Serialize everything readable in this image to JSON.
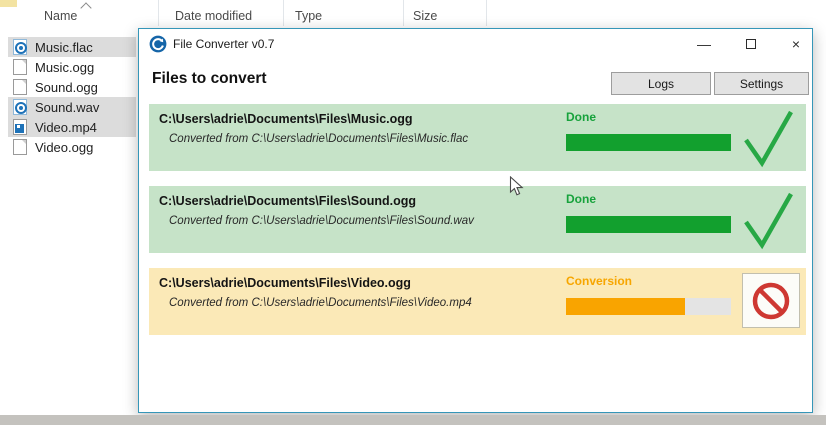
{
  "explorer": {
    "columns": [
      {
        "label": "Name",
        "sorted": "asc"
      },
      {
        "label": "Date modified",
        "sorted": ""
      },
      {
        "label": "Type",
        "sorted": ""
      },
      {
        "label": "Size",
        "sorted": ""
      }
    ],
    "files": [
      {
        "name": "Music.flac",
        "icon": "media-file-icon",
        "icon_class": "icon-media",
        "selected": true
      },
      {
        "name": "Music.ogg",
        "icon": "generic-file-icon",
        "icon_class": "icon-file",
        "selected": false
      },
      {
        "name": "Sound.ogg",
        "icon": "generic-file-icon",
        "icon_class": "icon-file",
        "selected": false
      },
      {
        "name": "Sound.wav",
        "icon": "media-file-icon",
        "icon_class": "icon-media",
        "selected": true
      },
      {
        "name": "Video.mp4",
        "icon": "video-file-icon",
        "icon_class": "icon-video",
        "selected": true
      },
      {
        "name": "Video.ogg",
        "icon": "generic-file-icon",
        "icon_class": "icon-file",
        "selected": false
      }
    ]
  },
  "window": {
    "title": "File Converter v0.7",
    "heading": "Files to convert",
    "logs_button": "Logs",
    "settings_button": "Settings",
    "minimize_glyph": "—",
    "close_glyph": "×"
  },
  "conversions": [
    {
      "output": "C:\\Users\\adrie\\Documents\\Files\\Music.ogg",
      "source": "Converted from C:\\Users\\adrie\\Documents\\Files\\Music.flac",
      "status": "Done",
      "state": "done",
      "progress": 100
    },
    {
      "output": "C:\\Users\\adrie\\Documents\\Files\\Sound.ogg",
      "source": "Converted from C:\\Users\\adrie\\Documents\\Files\\Sound.wav",
      "status": "Done",
      "state": "done",
      "progress": 100
    },
    {
      "output": "C:\\Users\\adrie\\Documents\\Files\\Video.ogg",
      "source": "Converted from C:\\Users\\adrie\\Documents\\Files\\Video.mp4",
      "status": "Conversion",
      "state": "in-progress",
      "progress": 72
    }
  ],
  "colors": {
    "done_text_green": "#17a23c",
    "progress_green": "#12a02e",
    "check_green": "#27a845",
    "card_green": "#c6e3c8",
    "card_yellow": "#fbe9b7",
    "conversion_orange": "#f7a600",
    "progress_orange": "#f9a400",
    "cancel_red": "#ce3832",
    "window_border_blue": "#3596b8",
    "app_icon_blue": "#1565a8"
  }
}
